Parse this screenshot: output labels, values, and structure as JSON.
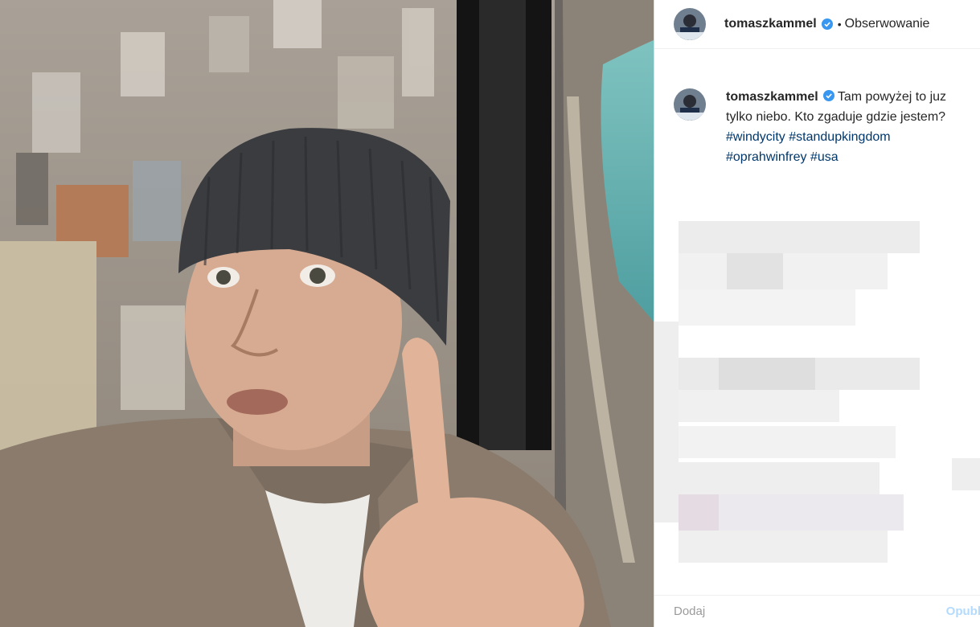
{
  "post": {
    "username": "tomaszkammel",
    "separator": "•",
    "follow_label": "Obserwowanie",
    "caption_text": "Tam powyżej to juz tylko niebo. Kto zgaduje gdzie jestem?",
    "hashtags": [
      "#windycity",
      "#standupkingdom",
      "#oprahwinfrey",
      "#usa"
    ]
  },
  "comment_box": {
    "placeholder": "Dodaj",
    "publish_label": "Opubl"
  },
  "colors": {
    "verified": "#3897f0",
    "link": "#00376b"
  },
  "icons": {
    "verified": "verified-badge-icon"
  }
}
